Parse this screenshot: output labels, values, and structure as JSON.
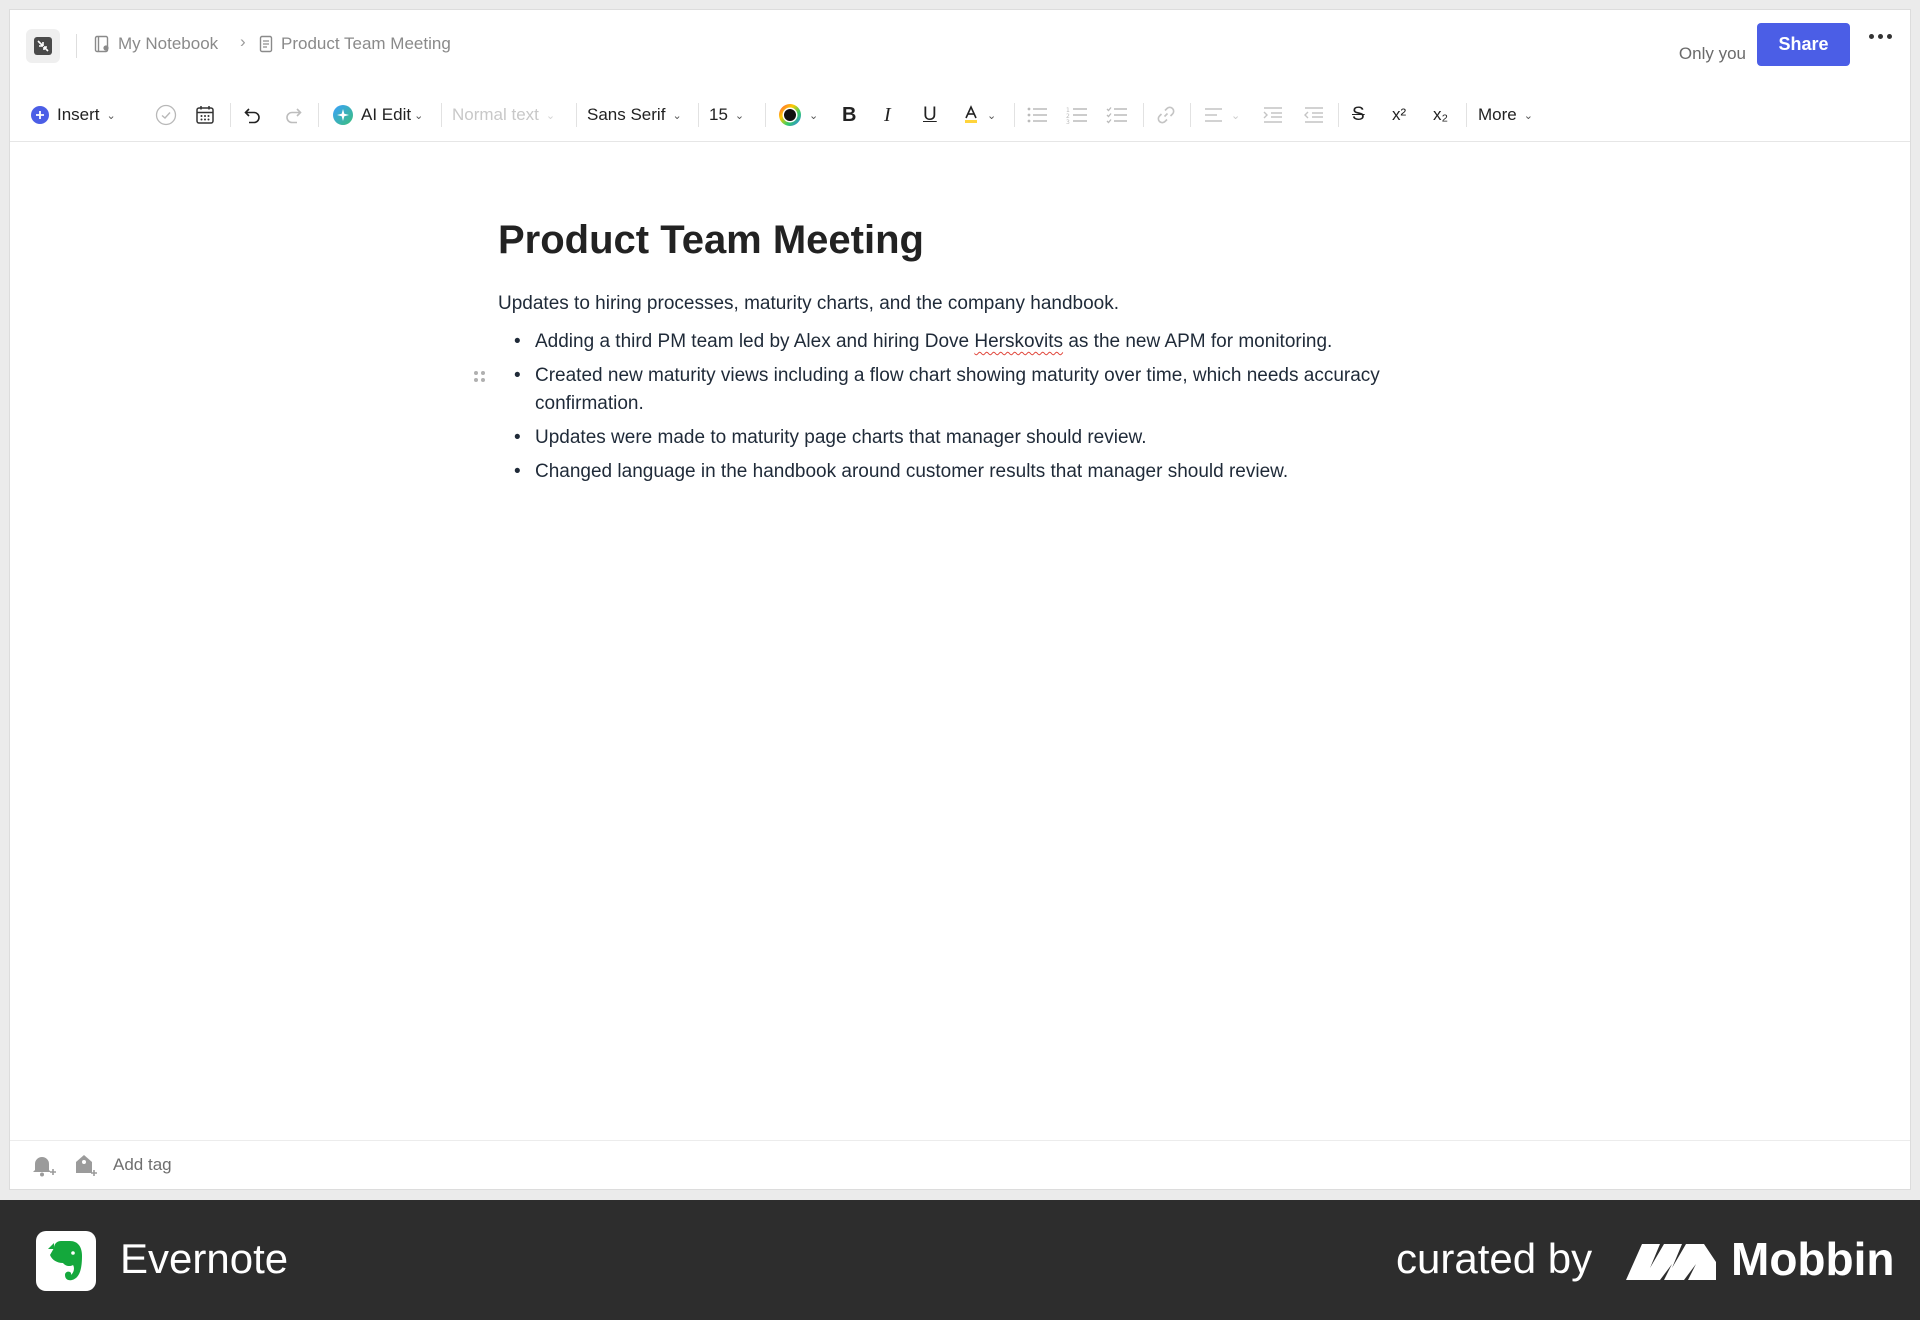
{
  "header": {
    "breadcrumb": [
      {
        "label": "My Notebook",
        "icon": "notebook-icon"
      },
      {
        "label": "Product Team Meeting",
        "icon": "note-icon"
      }
    ],
    "visibility": "Only you",
    "share_label": "Share"
  },
  "toolbar": {
    "insert_label": "Insert",
    "ai_edit_label": "AI Edit",
    "text_style": "Normal text",
    "font_family": "Sans Serif",
    "font_size": "15",
    "superscript_label": "x²",
    "subscript_label": "x₂",
    "more_label": "More"
  },
  "note": {
    "title": "Product Team Meeting",
    "intro": "Updates to hiring processes, maturity charts, and the company handbook.",
    "bullets": [
      {
        "before": "Adding a third PM team led by Alex and hiring Dove ",
        "flagged": "Herskovits",
        "after": " as the new APM for monitoring."
      },
      {
        "text": "Created new maturity views including a flow chart showing maturity over time, which needs accuracy confirmation."
      },
      {
        "text": "Updates were made to maturity page charts that manager should review."
      },
      {
        "text": "Changed language in the handbook around customer results that manager should review."
      }
    ]
  },
  "footer": {
    "add_tag_label": "Add tag"
  },
  "branding": {
    "app_name": "Evernote",
    "curated_label": "curated by",
    "curator_name": "Mobbin"
  },
  "colors": {
    "accent": "#4b5ee6",
    "evernote_green": "#14a83c",
    "branding_bar": "#2d2d2d"
  }
}
